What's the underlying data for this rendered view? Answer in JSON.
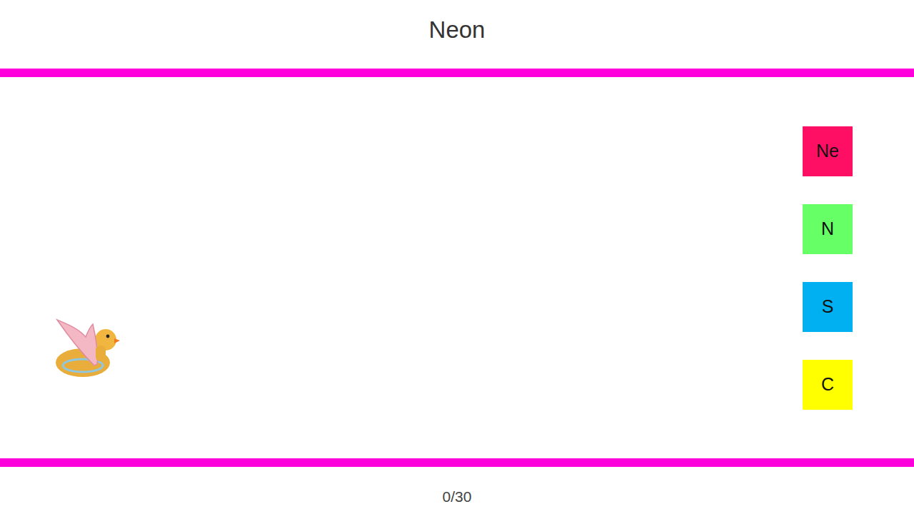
{
  "game": {
    "title": "Neon",
    "options": [
      {
        "label": "Ne",
        "color": "#fe0f64"
      },
      {
        "label": "N",
        "color": "#66ff66"
      },
      {
        "label": "S",
        "color": "#00b0f0"
      },
      {
        "label": "C",
        "color": "#ffff00"
      }
    ],
    "score": "0/30"
  }
}
